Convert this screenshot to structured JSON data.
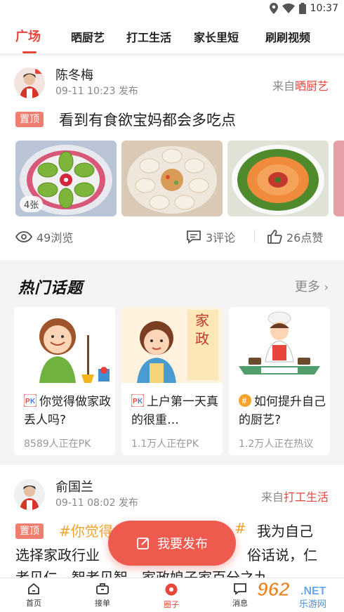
{
  "status_bar": {
    "time": "10:37"
  },
  "tabs": [
    {
      "label": "广场",
      "active": true
    },
    {
      "label": "晒厨艺"
    },
    {
      "label": "打工生活"
    },
    {
      "label": "家长里短"
    },
    {
      "label": "刷刷视频"
    }
  ],
  "post1": {
    "author": "陈冬梅",
    "time": "09-11 10:23 发布",
    "source_prefix": "来自",
    "source_name": "晒厨艺",
    "pin": "置顶",
    "title": "看到有食欲宝妈都会多吃点",
    "image_count": "4张",
    "views": "49浏览",
    "comments": "3评论",
    "likes": "26点赞"
  },
  "hot_topics": {
    "title": "热门话题",
    "more": "更多",
    "items": [
      {
        "badge": "PK",
        "question": "你觉得做家政丢人吗?",
        "sub": "8589人正在PK"
      },
      {
        "badge": "PK",
        "question": "上户第一天真的很重…",
        "sub": "1.1万人正在PK"
      },
      {
        "badge": "#",
        "question": "如何提升自己的厨艺?",
        "sub": "1.2万人正在热议"
      }
    ],
    "poster_text": "家政"
  },
  "post2": {
    "author": "俞国兰",
    "time": "09-11 08:02 发布",
    "source_prefix": "来自",
    "source_name": "打工生活",
    "pin": "置顶",
    "tag": "#你觉得",
    "tag_end": "#",
    "text_a": "我为自己",
    "text_b": "选择家政行业",
    "text_c": "俗话说，仁",
    "text_d": "者见仁，智者见智，家政娘子家百分之九"
  },
  "fab": {
    "label": "我要发布"
  },
  "bottom_nav": [
    {
      "label": "首页"
    },
    {
      "label": "接单"
    },
    {
      "label": "圈子",
      "active": true
    },
    {
      "label": "消息"
    }
  ],
  "watermark": {
    "text": "962.NET",
    "sub": "乐游网"
  },
  "colors": {
    "accent": "#e8453c",
    "fab": "#ee5a4e",
    "tag": "#f4a22a",
    "pin": "#ee7e6f"
  }
}
